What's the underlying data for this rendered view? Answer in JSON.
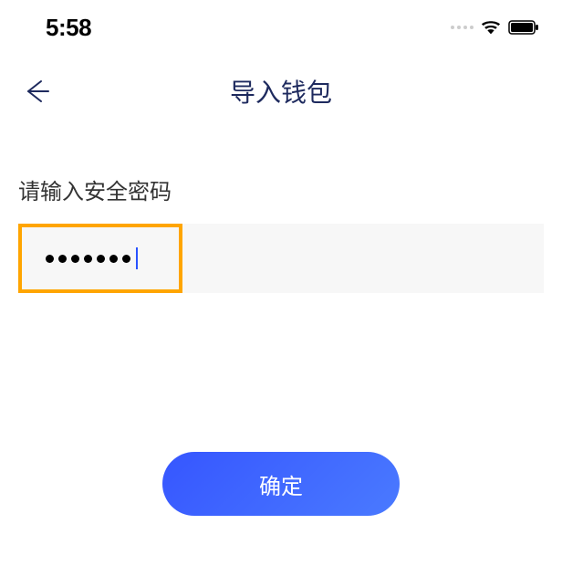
{
  "statusBar": {
    "time": "5:58"
  },
  "nav": {
    "title": "导入钱包"
  },
  "form": {
    "passwordLabel": "请输入安全密码",
    "passwordValue": "•••••••",
    "passwordLength": 7
  },
  "actions": {
    "confirmLabel": "确定"
  },
  "colors": {
    "accent": "#3656ff",
    "highlight": "#ffa500",
    "titleColor": "#1e2a5e"
  }
}
